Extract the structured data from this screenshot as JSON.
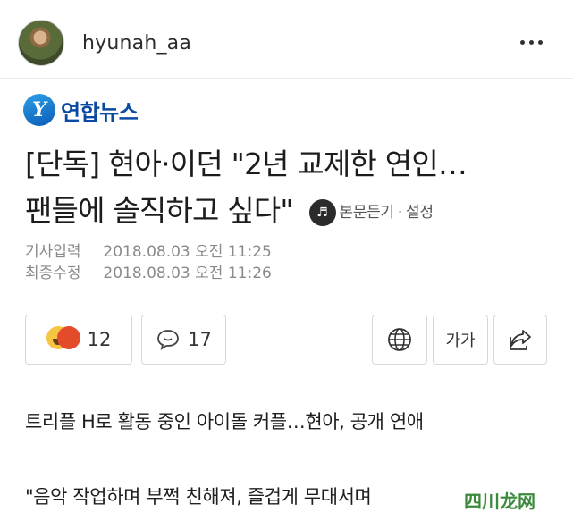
{
  "post": {
    "username": "hyunah_aa"
  },
  "article": {
    "logo_mark": "Y",
    "logo_text": "연합뉴스",
    "headline_line1": "[단독] 현아·이던 \"2년 교제한 연인…",
    "headline_line2": "팬들에 솔직하고 싶다\"",
    "listen_label": "본문듣기",
    "listen_sep": "·",
    "settings_label": "설정",
    "meta": [
      {
        "label": "기사입력",
        "value": "2018.08.03 오전 11:25"
      },
      {
        "label": "최종수정",
        "value": "2018.08.03 오전 11:26"
      }
    ],
    "reaction_count": "12",
    "comment_count": "17",
    "font_size_label": "가가",
    "paragraph1": "트리플 H로 활동 중인 아이돌 커플…현아, 공개 연애",
    "paragraph2": "\"음악 작업하며 부쩍 친해져, 즐겁게 무대서며"
  },
  "watermark": {
    "text": "四川龙网"
  }
}
